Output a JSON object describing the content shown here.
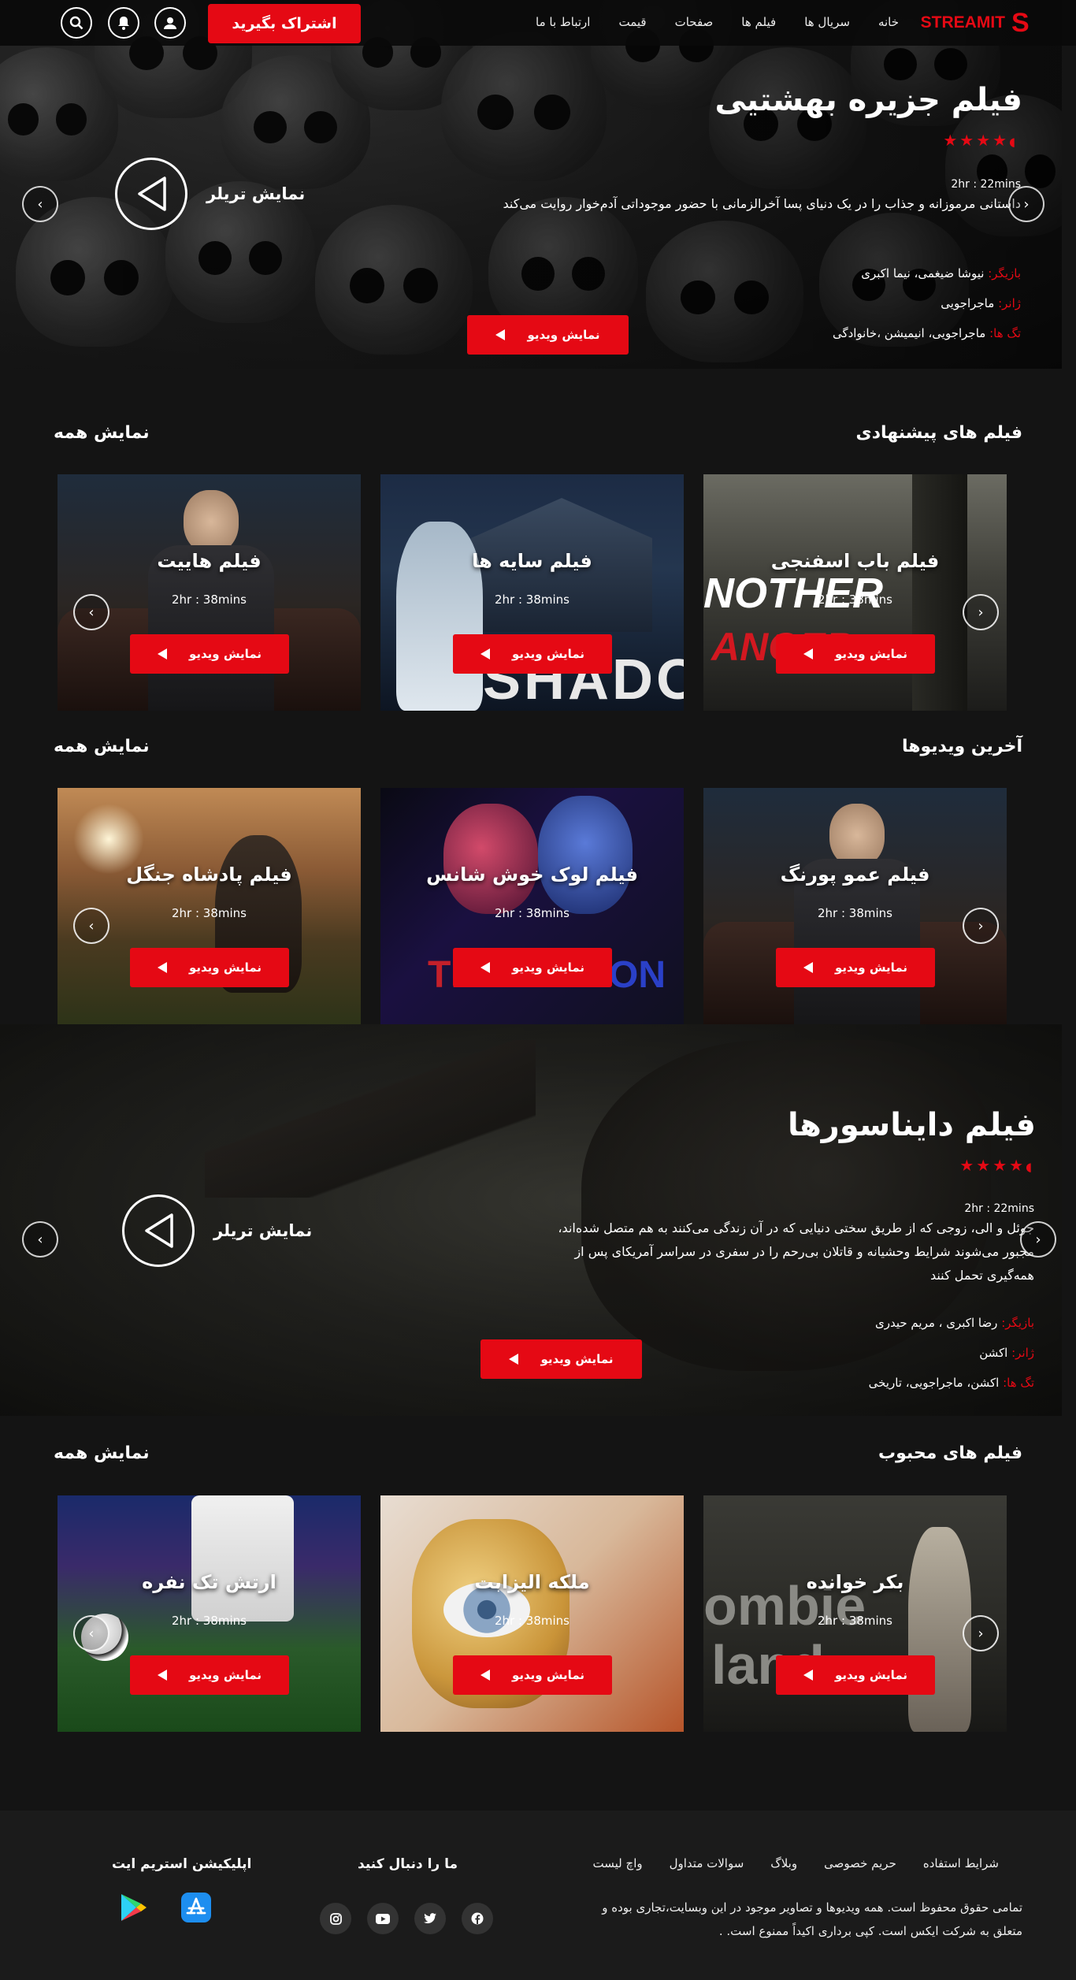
{
  "nav": {
    "brand": "STREAMIT",
    "brand_letter": "S",
    "menu": [
      "خانه",
      "سریال ها",
      "فیلم ها",
      "صفحات",
      "قیمت",
      "ارتباط با ما"
    ],
    "subscribe_label": "اشتراک بگیرید",
    "icons": [
      "user-icon",
      "bell-icon",
      "search-icon"
    ]
  },
  "hero1": {
    "title": "فیلم جزیره بهشتیی",
    "stars": "★★★★",
    "half_star": "◖",
    "rating": 4.5,
    "runtime": "2hr : 22mins",
    "description": "داستانی مرموزانه و جذاب را در یک دنیای پسا آخرالزمانی با حضور موجوداتی آدم‌خوار روایت می‌کند",
    "cast_key": "بازیگر:",
    "cast_val": "نیوشا ضیغمی، نیما اکبری",
    "genre_key": "ژانر:",
    "genre_val": "ماجراجویی",
    "tags_key": "تگ ها:",
    "tags_val": "ماجراجویی، انیمیشن ،خانوادگی",
    "play_label": "نمایش ویدیو",
    "trailer_label": "نمایش تریلر"
  },
  "sections": {
    "recommended": {
      "title": "فیلم های پیشنهادی",
      "view_all": "نمایش همه",
      "cards": [
        {
          "title": "فیلم باب اسفنجی",
          "runtime": "2hr : 38mins",
          "play": "نمایش ویدیو"
        },
        {
          "title": "فیلم سایه ها",
          "runtime": "2hr : 38mins",
          "play": "نمایش ویدیو"
        },
        {
          "title": "فیلم هاییت",
          "runtime": "2hr : 38mins",
          "play": "نمایش ویدیو"
        }
      ]
    },
    "latest": {
      "title": "آخرین ویدیوها",
      "view_all": "نمایش همه",
      "cards": [
        {
          "title": "فیلم عمو پورنگ",
          "runtime": "2hr : 38mins",
          "play": "نمایش ویدیو"
        },
        {
          "title": "فیلم لوک خوش شانس",
          "runtime": "2hr : 38mins",
          "play": "نمایش ویدیو"
        },
        {
          "title": "فیلم پادشاه جنگل",
          "runtime": "2hr : 38mins",
          "play": "نمایش ویدیو"
        }
      ]
    },
    "popular": {
      "title": "فیلم های محبوب",
      "view_all": "نمایش همه",
      "cards": [
        {
          "title": "بکر خوانده",
          "runtime": "2hr : 38mins",
          "play": "نمایش ویدیو"
        },
        {
          "title": "ملکه الیزابت",
          "runtime": "2hr : 38mins",
          "play": "نمایش ویدیو"
        },
        {
          "title": "ارتش تک نفره",
          "runtime": "2hr : 38mins",
          "play": "نمایش ویدیو"
        }
      ]
    }
  },
  "hero2": {
    "title": "فیلم دایناسورها",
    "stars": "★★★★",
    "half_star": "◖",
    "rating": 4.5,
    "runtime": "2hr : 22mins",
    "description": "جوئل و الی، زوجی که از طریق سختی دنیایی که در آن زندگی می‌کنند به هم متصل شده‌اند، مجبور می‌شوند شرایط وحشیانه و قاتلان بی‌رحم را در سفری در سراسر آمریکای پس از همه‌گیری تحمل کنند",
    "cast_key": "بازیگر:",
    "cast_val": "رضا اکبری ، مریم حیدری",
    "genre_key": "ژانر:",
    "genre_val": "اکشن",
    "tags_key": "تگ ها:",
    "tags_val": "اکشن، ماجراجویی، تاریخی",
    "play_label": "نمایش ویدیو",
    "trailer_label": "نمایش تریلر"
  },
  "card_overlays": {
    "poster_sponge": "NOTHER",
    "poster_sponge2": "ANGER",
    "poster_shadow": "SHADOW",
    "poster_luck": "TH",
    "poster_luck2": "ON",
    "poster_zombie": "ombie",
    "poster_zombie2": "land"
  },
  "footer": {
    "links": [
      "شرایط استفاده",
      "حریم خصوصی",
      "وبلاگ",
      "سوالات متداول",
      "واچ لیست"
    ],
    "copyright": "تمامی حقوق محفوظ است. همه ویدیوها و تصاویر موجود در این وبسایت،تجاری بوده و متعلق به شرکت ایکس است. کپی برداری اکیداً ممنوع است. .",
    "follow_title": "ما را دنبال کنید",
    "app_title": "اپلیکیشن استریم ایت",
    "social_icons": [
      "facebook-icon",
      "twitter-icon",
      "youtube-icon",
      "instagram-icon"
    ],
    "store_icons": [
      "app-store-icon",
      "google-play-icon"
    ]
  },
  "colors": {
    "accent": "#e50914",
    "background": "#141414",
    "footer": "#1b1b1b"
  }
}
